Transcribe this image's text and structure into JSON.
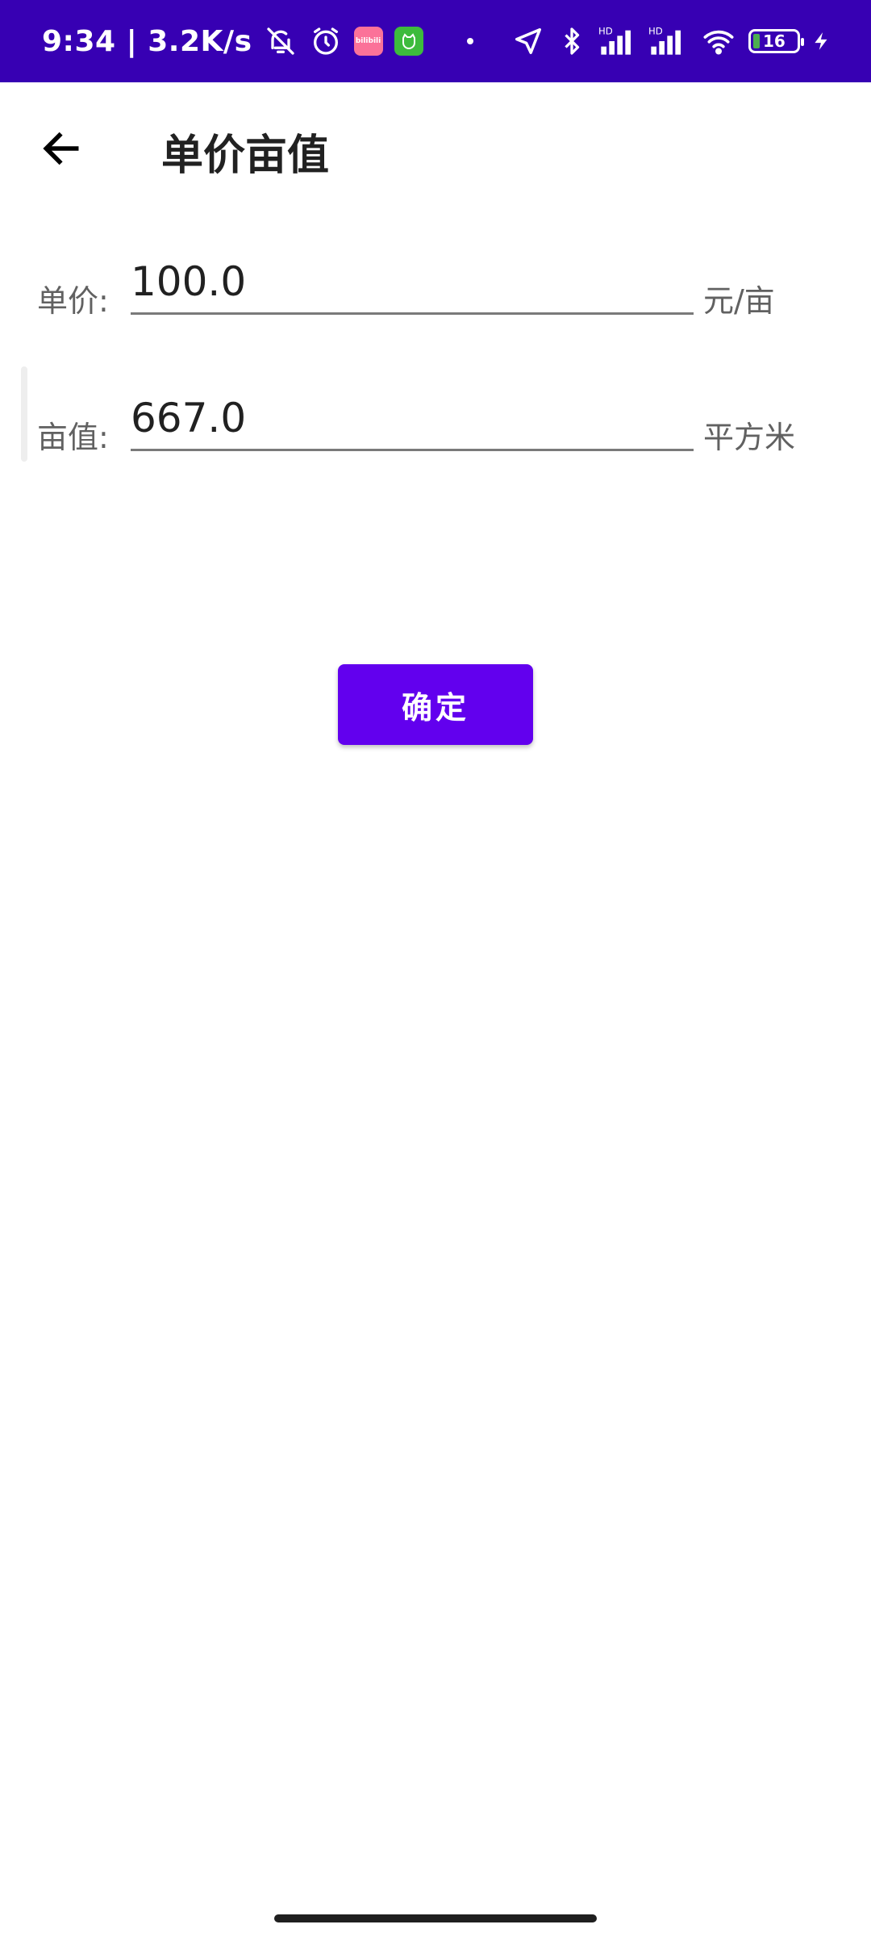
{
  "status_bar": {
    "time_speed": "9:34 | 3.2K/s",
    "battery_level": "16",
    "app_badge_bilibili": "bilibili",
    "background_color": "#3700b3",
    "icons": [
      "mute-icon",
      "alarm-icon",
      "bilibili-app-icon",
      "cat-app-icon",
      "location-arrow-icon",
      "bluetooth-icon",
      "signal-hd-icon",
      "signal-hd-icon",
      "wifi-icon",
      "battery-icon",
      "charging-icon"
    ]
  },
  "app_bar": {
    "title": "单价亩值",
    "back_icon": "arrow-left-icon"
  },
  "form": {
    "price": {
      "label": "单价:",
      "value": "100.0",
      "unit": "元/亩"
    },
    "area": {
      "label": "亩值:",
      "value": "667.0",
      "unit": "平方米"
    }
  },
  "confirm_button": {
    "label": "确定",
    "color": "#6200ee"
  }
}
